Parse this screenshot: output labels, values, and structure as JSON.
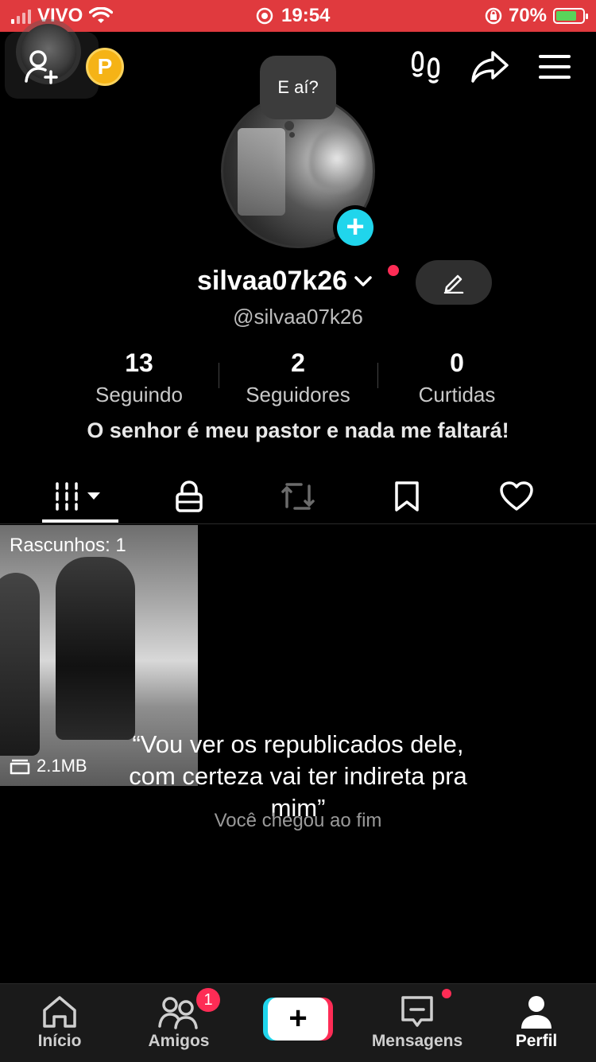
{
  "status_bar": {
    "carrier": "VIVO",
    "time": "19:54",
    "battery_percent": "70%",
    "battery_level": 0.7
  },
  "profile": {
    "speech_bubble": "E aí?",
    "display_name": "silvaa07k26",
    "handle": "@silvaa07k26",
    "coin_label": "P",
    "stats": [
      {
        "value": "13",
        "label": "Seguindo"
      },
      {
        "value": "2",
        "label": "Seguidores"
      },
      {
        "value": "0",
        "label": "Curtidas"
      }
    ],
    "bio": "O senhor é meu pastor e nada me faltará!"
  },
  "tabs": [
    {
      "icon": "grid-icon",
      "active": true
    },
    {
      "icon": "lock-icon",
      "active": false
    },
    {
      "icon": "repost-icon",
      "active": false
    },
    {
      "icon": "bookmark-icon",
      "active": false
    },
    {
      "icon": "heart-icon",
      "active": false
    }
  ],
  "content": {
    "drafts_label": "Rascunhos: 1",
    "draft_size": "2.1MB",
    "caption": "“Vou ver os republicados dele, com certeza vai ter indireta pra mim”",
    "end_text": "Você chegou ao fim"
  },
  "bottom_nav": {
    "items": [
      {
        "label": "Início",
        "icon": "home-icon"
      },
      {
        "label": "Amigos",
        "icon": "friends-icon"
      },
      {
        "label": "",
        "icon": "create-icon"
      },
      {
        "label": "Mensagens",
        "icon": "messages-icon"
      },
      {
        "label": "Perfil",
        "icon": "profile-icon"
      }
    ],
    "friends_badge": "1"
  },
  "colors": {
    "status_bar": "#e03a3e",
    "accent_cyan": "#20d5ec",
    "accent_red": "#fe2c55",
    "background": "#000000"
  }
}
